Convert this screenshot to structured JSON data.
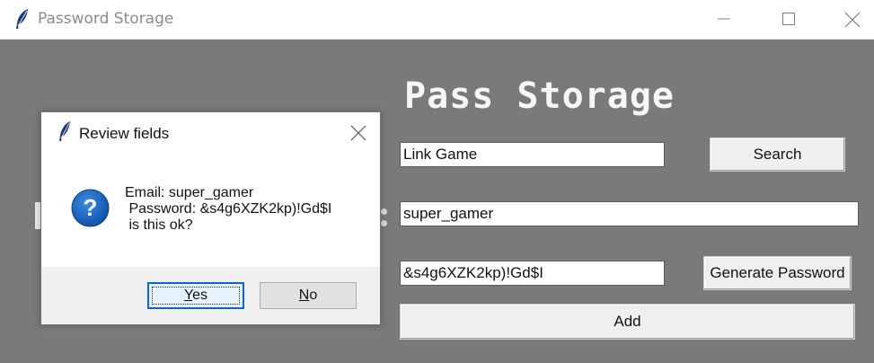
{
  "window": {
    "title": "Password Storage",
    "icons": {
      "app": "feather-icon",
      "minimize": "minimize-icon",
      "maximize": "maximize-icon",
      "close": "close-icon"
    }
  },
  "main": {
    "heading": "Pass Storage",
    "website_value": "Link Game",
    "email_value": "super_gamer",
    "password_value": "&s4g6XZK2kp)!Gd$I",
    "search_label": "Search",
    "generate_label": "Generate Password",
    "add_label": "Add"
  },
  "dialog": {
    "title": "Review fields",
    "icon": "question-icon",
    "message": "Email: super_gamer\n Password: &s4g6XZK2kp)!Gd$I\n is this ok?",
    "yes_first": "Y",
    "yes_rest": "es",
    "no_first": "N",
    "no_rest": "o"
  },
  "colors": {
    "canvas_bg": "#7a7a7a",
    "heading": "#f6f6f6",
    "dialog_focus": "#0a66d0",
    "question_icon": "#1565c0"
  }
}
